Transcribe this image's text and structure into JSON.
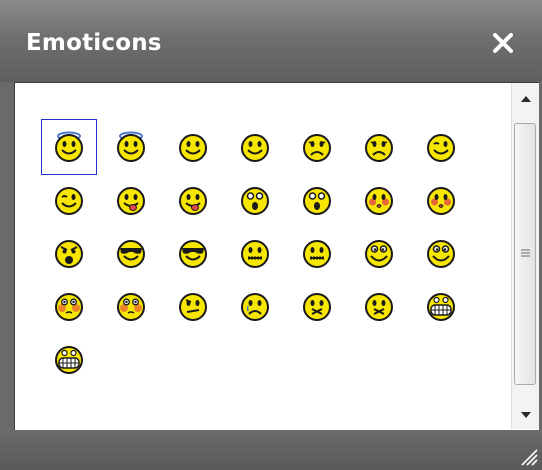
{
  "dialog": {
    "title": "Emoticons",
    "close_icon": "close-x-icon"
  },
  "emoticons": [
    {
      "name": "angel",
      "selected": true
    },
    {
      "name": "angel-2"
    },
    {
      "name": "smile"
    },
    {
      "name": "smile-2"
    },
    {
      "name": "sad"
    },
    {
      "name": "sad-2"
    },
    {
      "name": "wink"
    },
    {
      "name": "wink-2"
    },
    {
      "name": "tongue"
    },
    {
      "name": "tongue-2"
    },
    {
      "name": "surprised"
    },
    {
      "name": "surprised-2"
    },
    {
      "name": "kiss"
    },
    {
      "name": "kiss-2"
    },
    {
      "name": "angry"
    },
    {
      "name": "cool"
    },
    {
      "name": "cool-2"
    },
    {
      "name": "zipped"
    },
    {
      "name": "zipped-2"
    },
    {
      "name": "silly"
    },
    {
      "name": "silly-2"
    },
    {
      "name": "embarrassed"
    },
    {
      "name": "embarrassed-2"
    },
    {
      "name": "confused"
    },
    {
      "name": "crying"
    },
    {
      "name": "sealed"
    },
    {
      "name": "sealed-2"
    },
    {
      "name": "grin"
    },
    {
      "name": "grin-2"
    }
  ],
  "colors": {
    "face": "#f6e600",
    "outline": "#1a1a1a",
    "halo": "#4a78c8",
    "blush": "#e24848",
    "selection": "#2233cc"
  }
}
